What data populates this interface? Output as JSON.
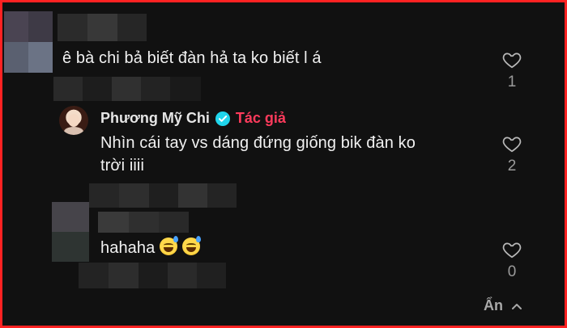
{
  "comments": [
    {
      "text": "ê bà chi bả biết đàn hả ta ko biết l á",
      "likes": "1"
    },
    {
      "author": "Phương Mỹ Chi",
      "author_badge": "Tác giả",
      "text_line1": "Nhìn cái tay vs dáng đứng giống bik đàn ko",
      "text_line2": "trời iiii",
      "likes": "2"
    },
    {
      "text": "hahaha",
      "likes": "0"
    }
  ],
  "hide_label": "Ẩn",
  "icons": {
    "like": "heart-outline-icon",
    "verified": "verified-check-icon",
    "hide": "chevron-up-icon",
    "emoji": "sweat-smile-emoji"
  },
  "colors": {
    "background": "#111111",
    "border": "#ff2222",
    "author_badge": "#ff3b5c",
    "verified": "#20d5ec"
  }
}
